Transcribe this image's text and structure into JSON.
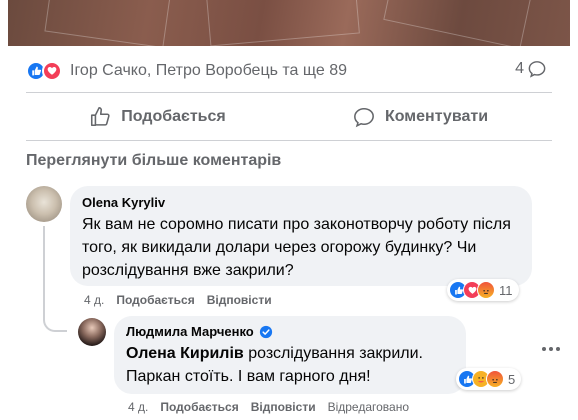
{
  "post": {
    "reaction_names": "Ігор Сачко, Петро Воробець та ще 89",
    "comment_count": "4",
    "like_action": "Подобається",
    "comment_action": "Коментувати",
    "more_comments": "Переглянути більше коментарів"
  },
  "comments": [
    {
      "author": "Olena Kyryliv",
      "text": "Як вам не соромно писати про законотворчу роботу після того, як викидали долари через огорожу будинку? Чи розслідування вже закрили?",
      "time": "4 д.",
      "like_label": "Подобається",
      "reply_label": "Відповісти",
      "reaction_count": "11",
      "reactions": [
        "like-icon",
        "love-icon",
        "angry-icon"
      ]
    },
    {
      "author": "Людмила Марченко",
      "mention": "Олена Кирилів",
      "text_after_mention": " розслідування закрили.",
      "text_line2": "Паркан стоїть. І вам гарного дня!",
      "time": "4 д.",
      "like_label": "Подобається",
      "reply_label": "Відповісти",
      "edited_label": "Відредаговано",
      "reaction_count": "5",
      "reactions": [
        "like-icon",
        "care-icon",
        "angry-icon"
      ]
    }
  ],
  "colors": {
    "accent": "#1877f2",
    "secondary_text": "#65676b",
    "bubble": "#f0f2f5"
  }
}
